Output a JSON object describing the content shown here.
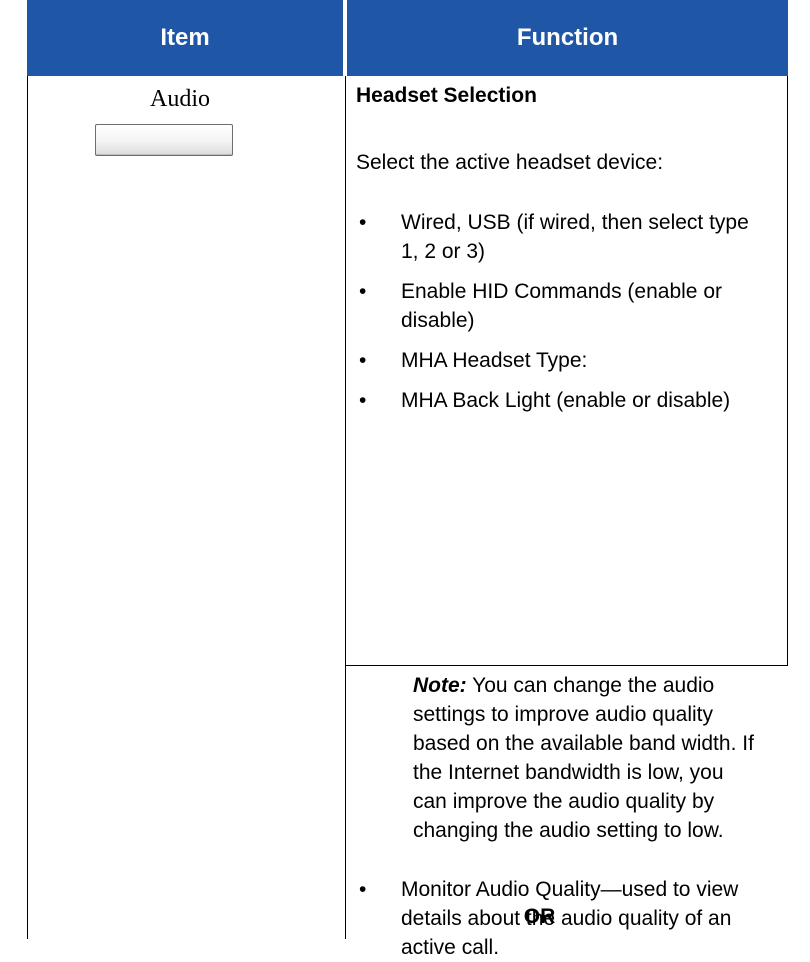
{
  "table": {
    "header": {
      "item": "Item",
      "function": "Function"
    }
  },
  "item": {
    "label": "Audio"
  },
  "function": {
    "heading": "Headset Selection",
    "intro": "Select the active headset device:",
    "bullets": [
      "Wired, USB (if wired, then select type 1, 2 or 3)",
      "Enable HID Commands (enable or disable)",
      "MHA Headset Type:",
      "MHA Back Light (enable or disable)"
    ],
    "bullet_char": "•",
    "note_label": "Note:",
    "note_text": " You can change the audio settings to improve audio quality based on the available band width. If the Internet bandwidth is low, you can improve the audio quality by changing the audio setting to low.",
    "monitor": "Monitor Audio Quality—used to view details about the audio quality of an active call.",
    "or": "OR"
  }
}
